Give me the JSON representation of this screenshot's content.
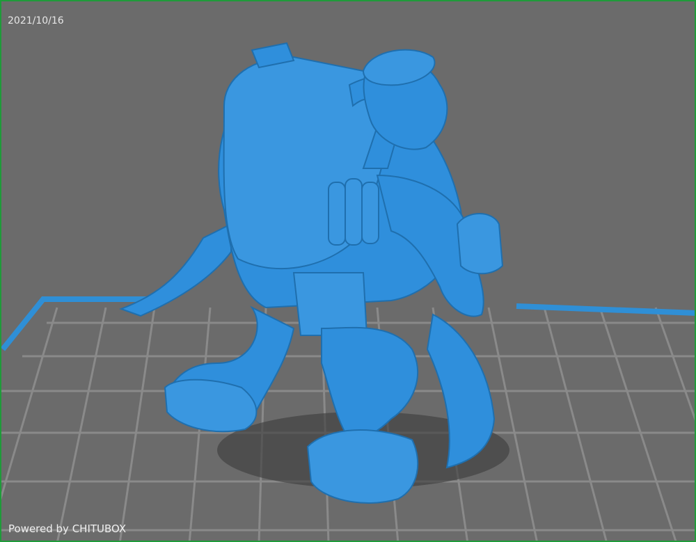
{
  "viewport": {
    "date_stamp": "2021/10/16",
    "footer_text": "Powered by CHITUBOX",
    "colors": {
      "background": "#6b6b6b",
      "frame_border": "#1f9b3a",
      "grid_line": "#8a8a8a",
      "plate_edge": "#2f8fd6",
      "model_fill": "#2f8fdc",
      "model_shade": "#1f6fae",
      "shadow": "#3f3f3f"
    }
  }
}
